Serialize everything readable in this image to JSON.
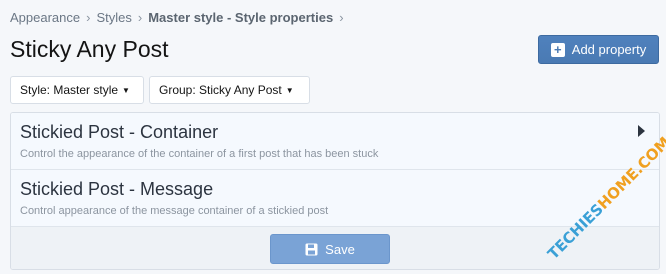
{
  "breadcrumb": {
    "items": [
      "Appearance",
      "Styles",
      "Master style - Style properties"
    ]
  },
  "page": {
    "title": "Sticky Any Post",
    "add_property_label": "Add property"
  },
  "filters": {
    "style_label": "Style: Master style",
    "group_label": "Group: Sticky Any Post"
  },
  "properties": [
    {
      "title": "Stickied Post - Container",
      "description": "Control the appearance of the container of a first post that has been stuck"
    },
    {
      "title": "Stickied Post - Message",
      "description": "Control appearance of the message container of a stickied post"
    }
  ],
  "footer": {
    "save_label": "Save"
  },
  "watermark": {
    "text_a": "TECHIES",
    "text_b": "HOME.COM"
  },
  "colors": {
    "accent": "#4a7ab3",
    "save_button": "#7aa3d6",
    "watermark_blue": "#3aa0d6",
    "watermark_orange": "#f0a020"
  }
}
